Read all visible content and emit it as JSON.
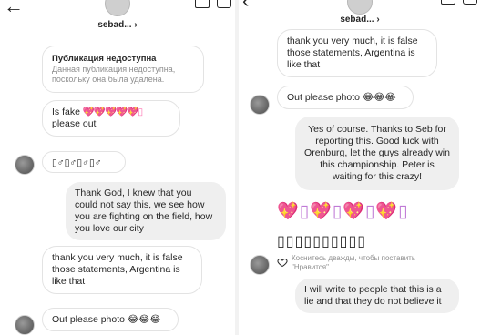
{
  "header": {
    "username": "sebad... ›"
  },
  "left": {
    "unavailable": {
      "title": "Публикация недоступна",
      "desc": "Данная публикация недоступна, поскольку она была удалена."
    },
    "msg_fake_prefix": "Is fake",
    "msg_fake_emoji": "💖💖💖💖💖▯",
    "msg_fake_suffix": "please out",
    "msg_symbols": "▯♂▯♂▯♂▯♂",
    "msg_thank_god": "Thank God, I knew that you could not say this, we see how you are fighting on the field, how you love our city",
    "msg_thank_you": "thank you very much, it is false those statements, Argentina is like that",
    "msg_out_photo": "Out please photo 😂😂😂"
  },
  "right": {
    "msg_thank_you_top": "thank you very much, it is false those statements, Argentina is like that",
    "msg_out_photo": "Out please photo 😂😂😂",
    "msg_yes": "Yes of course. Thanks to Seb for reporting this. Good luck with Orenburg, let the guys already win this championship. Peter is waiting for this crazy!",
    "emoji_row": "💖▯💖▯💖▯💖▯",
    "boxes_row": "▯▯▯▯▯▯▯▯▯▯",
    "like_hint": "Коснитесь дважды, чтобы поставить \"Нравится\"",
    "msg_write": "I will write to people that this is a lie and that they do not believe it"
  }
}
